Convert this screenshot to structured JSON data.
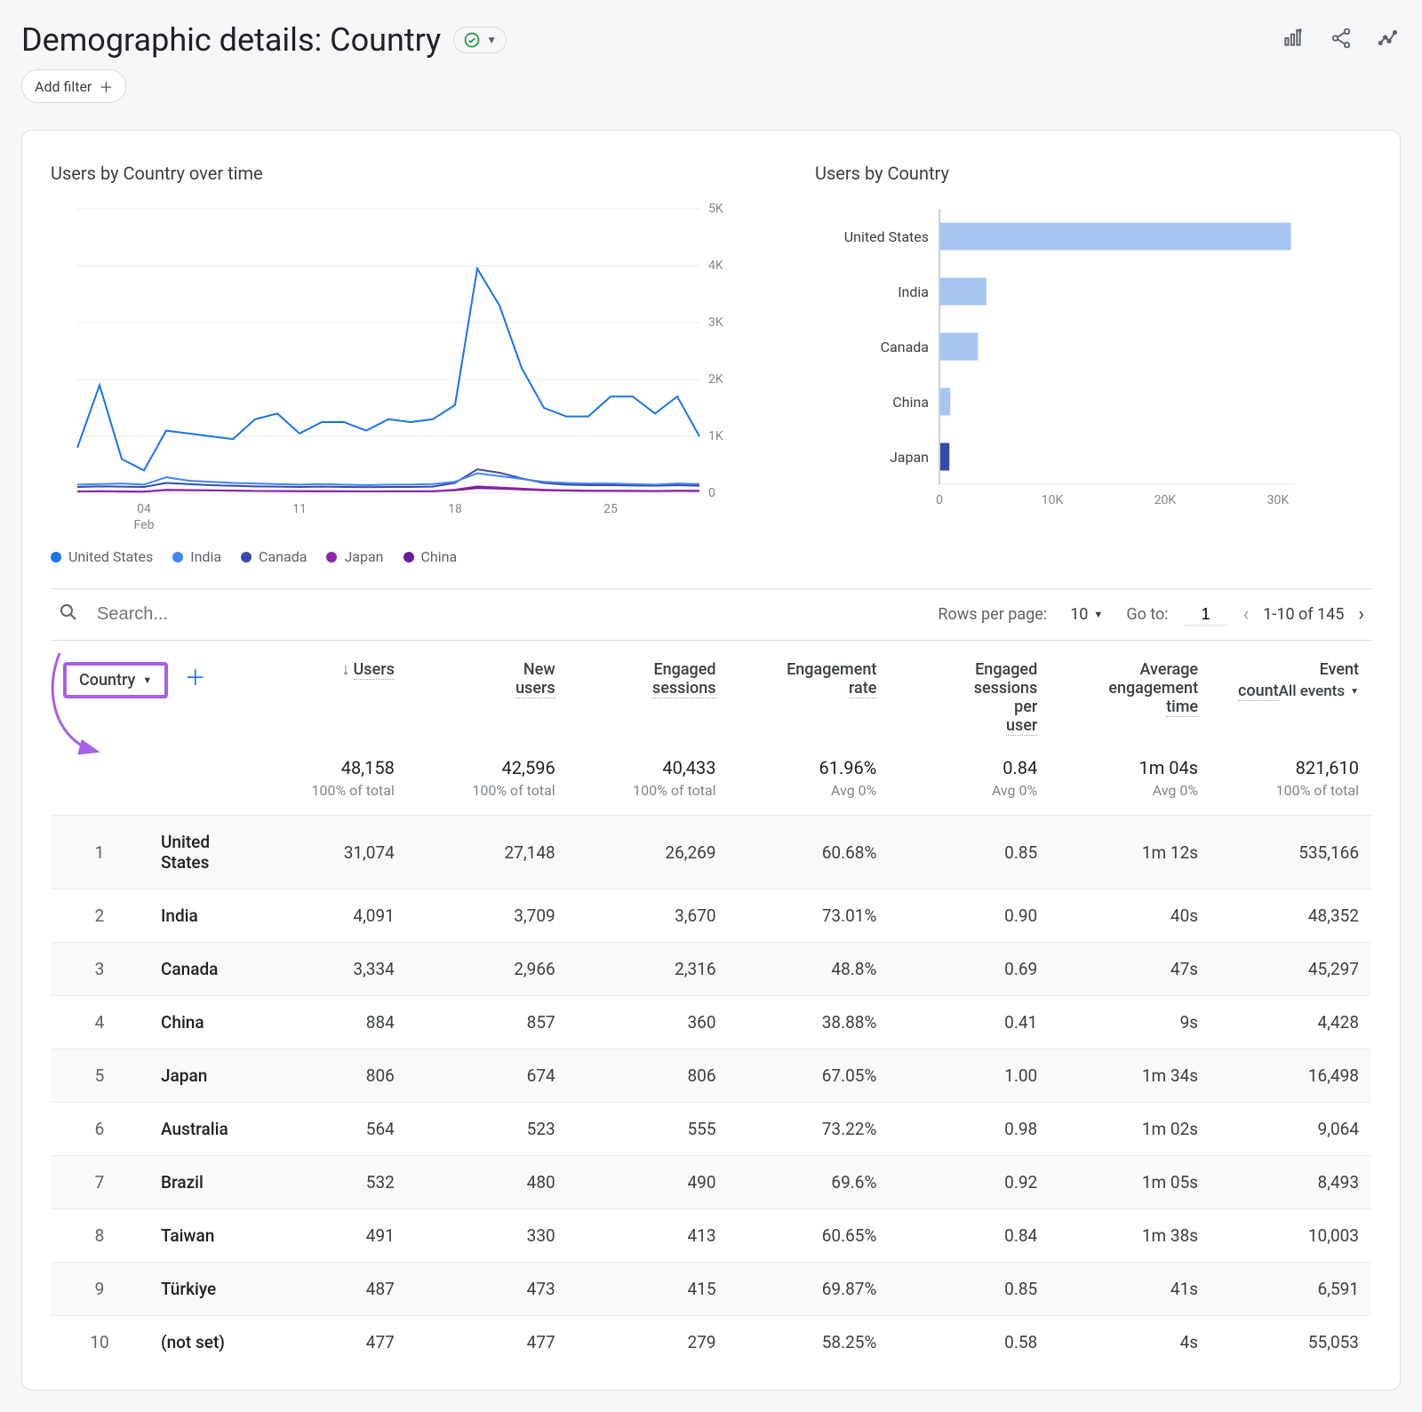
{
  "header": {
    "title": "Demographic details: Country",
    "add_filter_label": "Add filter"
  },
  "chart_data": [
    {
      "type": "line",
      "title": "Users by Country over time",
      "x_tick_labels": [
        "04",
        "11",
        "18",
        "25"
      ],
      "x_secondary_label": "Feb",
      "y_ticks": [
        0,
        1000,
        2000,
        3000,
        4000,
        5000
      ],
      "y_tick_labels": [
        "0",
        "1K",
        "2K",
        "3K",
        "4K",
        "5K"
      ],
      "x_days": [
        1,
        2,
        3,
        4,
        5,
        6,
        7,
        8,
        9,
        10,
        11,
        12,
        13,
        14,
        15,
        16,
        17,
        18,
        19,
        20,
        21,
        22,
        23,
        24,
        25,
        26,
        27,
        28,
        29
      ],
      "series": [
        {
          "name": "United States",
          "color": "#1a73e8",
          "values": [
            800,
            1900,
            600,
            400,
            1100,
            1050,
            1000,
            950,
            1300,
            1400,
            1050,
            1250,
            1250,
            1100,
            1300,
            1250,
            1300,
            1550,
            3950,
            3300,
            2200,
            1500,
            1350,
            1350,
            1700,
            1700,
            1400,
            1700,
            1000
          ]
        },
        {
          "name": "India",
          "color": "#4285f4",
          "values": [
            150,
            160,
            170,
            150,
            280,
            220,
            200,
            180,
            170,
            160,
            150,
            160,
            150,
            140,
            150,
            150,
            160,
            200,
            350,
            300,
            250,
            200,
            180,
            170,
            170,
            160,
            150,
            170,
            160
          ]
        },
        {
          "name": "Canada",
          "color": "#3949ab",
          "values": [
            110,
            120,
            115,
            110,
            180,
            160,
            140,
            130,
            120,
            115,
            110,
            115,
            110,
            105,
            110,
            110,
            115,
            180,
            420,
            360,
            260,
            180,
            150,
            140,
            140,
            135,
            130,
            140,
            130
          ]
        },
        {
          "name": "Japan",
          "color": "#8e24aa",
          "values": [
            30,
            35,
            30,
            28,
            60,
            55,
            50,
            45,
            40,
            38,
            35,
            36,
            34,
            32,
            34,
            34,
            36,
            60,
            120,
            100,
            80,
            60,
            50,
            45,
            44,
            42,
            40,
            44,
            42
          ]
        },
        {
          "name": "China",
          "color": "#6a1b9a",
          "values": [
            32,
            34,
            30,
            28,
            55,
            50,
            48,
            44,
            40,
            38,
            35,
            34,
            33,
            32,
            33,
            33,
            34,
            50,
            90,
            80,
            65,
            50,
            44,
            40,
            40,
            38,
            36,
            40,
            38
          ]
        }
      ]
    },
    {
      "type": "bar",
      "title": "Users by Country",
      "orientation": "horizontal",
      "x_ticks": [
        0,
        10000,
        20000,
        30000
      ],
      "x_tick_labels": [
        "0",
        "10K",
        "20K",
        "30K"
      ],
      "categories": [
        "United States",
        "India",
        "Canada",
        "China",
        "Japan"
      ],
      "values": [
        31074,
        4091,
        3334,
        884,
        806
      ],
      "colors": [
        "#a7c7f2",
        "#a7c7f2",
        "#a7c7f2",
        "#a7c7f2",
        "#3949ab"
      ]
    }
  ],
  "table_controls": {
    "search_placeholder": "Search...",
    "rows_per_page_label": "Rows per page:",
    "rows_per_page_value": "10",
    "go_to_label": "Go to:",
    "go_to_value": "1",
    "range_label": "1-10 of 145"
  },
  "table": {
    "dimension_label": "Country",
    "columns": [
      {
        "label": "Users",
        "sort_desc": true
      },
      {
        "label": "New users"
      },
      {
        "label": "Engaged sessions"
      },
      {
        "label": "Engagement rate"
      },
      {
        "label": "Engaged sessions per user"
      },
      {
        "label": "Average engagement time"
      },
      {
        "label": "Event count",
        "sublabel": "All events"
      }
    ],
    "totals": {
      "values": [
        "48,158",
        "42,596",
        "40,433",
        "61.96%",
        "0.84",
        "1m 04s",
        "821,610"
      ],
      "subs": [
        "100% of total",
        "100% of total",
        "100% of total",
        "Avg 0%",
        "Avg 0%",
        "Avg 0%",
        "100% of total"
      ]
    },
    "rows": [
      {
        "idx": "1",
        "name": "United States",
        "cells": [
          "31,074",
          "27,148",
          "26,269",
          "60.68%",
          "0.85",
          "1m 12s",
          "535,166"
        ]
      },
      {
        "idx": "2",
        "name": "India",
        "cells": [
          "4,091",
          "3,709",
          "3,670",
          "73.01%",
          "0.90",
          "40s",
          "48,352"
        ]
      },
      {
        "idx": "3",
        "name": "Canada",
        "cells": [
          "3,334",
          "2,966",
          "2,316",
          "48.8%",
          "0.69",
          "47s",
          "45,297"
        ]
      },
      {
        "idx": "4",
        "name": "China",
        "cells": [
          "884",
          "857",
          "360",
          "38.88%",
          "0.41",
          "9s",
          "4,428"
        ]
      },
      {
        "idx": "5",
        "name": "Japan",
        "cells": [
          "806",
          "674",
          "806",
          "67.05%",
          "1.00",
          "1m 34s",
          "16,498"
        ]
      },
      {
        "idx": "6",
        "name": "Australia",
        "cells": [
          "564",
          "523",
          "555",
          "73.22%",
          "0.98",
          "1m 02s",
          "9,064"
        ]
      },
      {
        "idx": "7",
        "name": "Brazil",
        "cells": [
          "532",
          "480",
          "490",
          "69.6%",
          "0.92",
          "1m 05s",
          "8,493"
        ]
      },
      {
        "idx": "8",
        "name": "Taiwan",
        "cells": [
          "491",
          "330",
          "413",
          "60.65%",
          "0.84",
          "1m 38s",
          "10,003"
        ]
      },
      {
        "idx": "9",
        "name": "Türkiye",
        "cells": [
          "487",
          "473",
          "415",
          "69.87%",
          "0.85",
          "41s",
          "6,591"
        ]
      },
      {
        "idx": "10",
        "name": "(not set)",
        "cells": [
          "477",
          "477",
          "279",
          "58.25%",
          "0.58",
          "4s",
          "55,053"
        ]
      }
    ]
  }
}
